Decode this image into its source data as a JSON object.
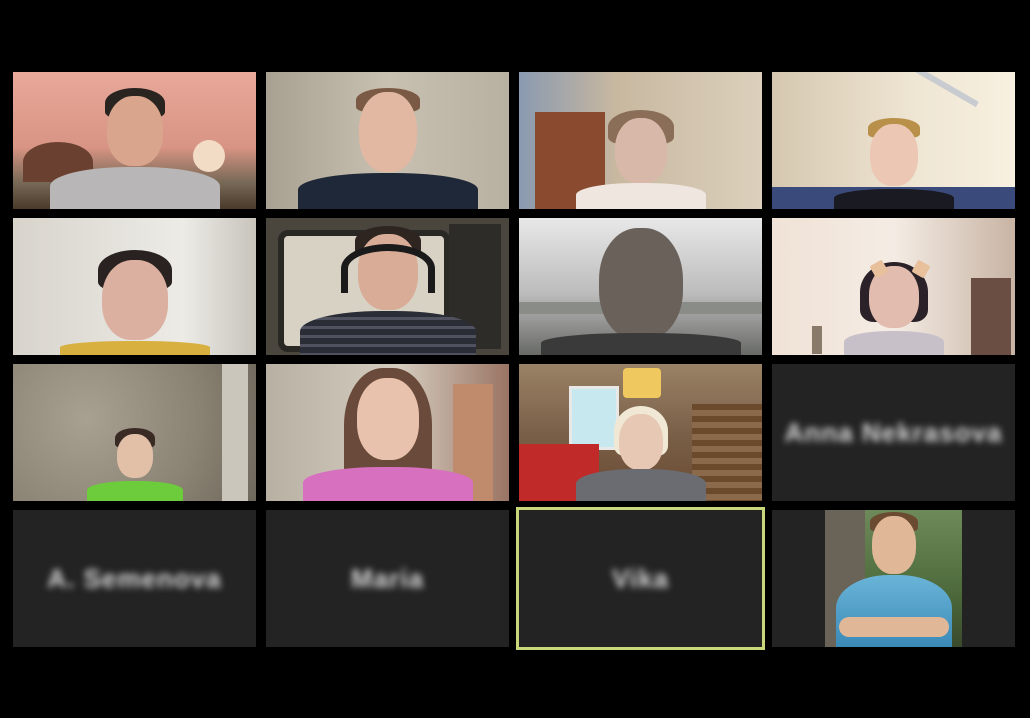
{
  "meeting": {
    "view": "gallery",
    "tiles": [
      {
        "label": "",
        "video": true
      },
      {
        "label": "",
        "video": true
      },
      {
        "label": "",
        "video": true
      },
      {
        "label": "",
        "video": true
      },
      {
        "label": "",
        "video": true
      },
      {
        "label": "",
        "video": true
      },
      {
        "label": "",
        "video": true
      },
      {
        "label": "",
        "video": true
      },
      {
        "label": "",
        "video": true
      },
      {
        "label": "",
        "video": true
      },
      {
        "label": "",
        "video": true
      },
      {
        "label": "Anna Nekrasova",
        "video": false
      },
      {
        "label": "A. Semenova",
        "video": false
      },
      {
        "label": "Maria",
        "video": false
      },
      {
        "label": "Vika",
        "video": false,
        "active_speaker": true
      },
      {
        "label": "",
        "video": false,
        "profile_photo": true
      }
    ],
    "colors": {
      "background": "#000000",
      "tile_empty": "#232323",
      "active_speaker_border": "#c9d77a"
    }
  }
}
